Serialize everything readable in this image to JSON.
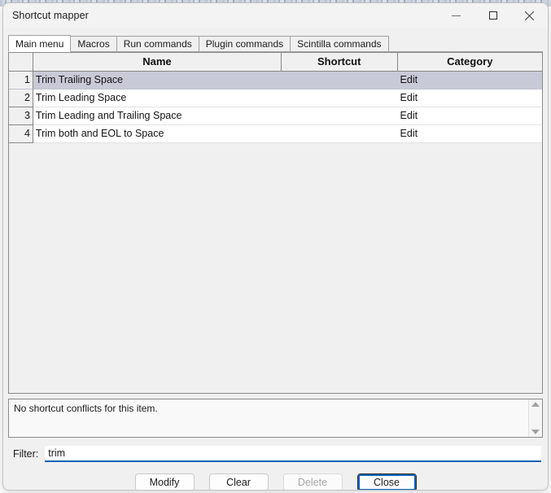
{
  "window": {
    "title": "Shortcut mapper",
    "controls": [
      {
        "name": "minimize",
        "icon": "minimize-icon"
      },
      {
        "name": "maximize",
        "icon": "maximize-icon"
      },
      {
        "name": "close",
        "icon": "close-icon"
      }
    ]
  },
  "tabs": [
    {
      "label": "Main menu",
      "active": true
    },
    {
      "label": "Macros",
      "active": false
    },
    {
      "label": "Run commands",
      "active": false
    },
    {
      "label": "Plugin commands",
      "active": false
    },
    {
      "label": "Scintilla commands",
      "active": false
    }
  ],
  "table": {
    "columns": [
      "",
      "Name",
      "Shortcut",
      "Category"
    ],
    "rows": [
      {
        "num": "1",
        "name": "Trim Trailing Space",
        "shortcut": "",
        "category": "Edit",
        "selected": true
      },
      {
        "num": "2",
        "name": "Trim Leading Space",
        "shortcut": "",
        "category": "Edit",
        "selected": false
      },
      {
        "num": "3",
        "name": "Trim Leading and Trailing Space",
        "shortcut": "",
        "category": "Edit",
        "selected": false
      },
      {
        "num": "4",
        "name": "Trim both and EOL to Space",
        "shortcut": "",
        "category": "Edit",
        "selected": false
      }
    ]
  },
  "conflicts": {
    "message": "No shortcut conflicts for this item.",
    "scrollbar": {
      "up": "scroll-up-icon",
      "down": "scroll-down-icon"
    }
  },
  "filter": {
    "label": "Filter:",
    "value": "trim",
    "placeholder": ""
  },
  "buttons": [
    {
      "label": "Modify",
      "name": "modify-button",
      "state": "enabled"
    },
    {
      "label": "Clear",
      "name": "clear-button",
      "state": "enabled"
    },
    {
      "label": "Delete",
      "name": "delete-button",
      "state": "disabled"
    },
    {
      "label": "Close",
      "name": "close-button",
      "state": "default"
    }
  ],
  "colors": {
    "selection": "#c9cad8",
    "focus_accent": "#0a62b8",
    "window_bg": "#f0f0f0",
    "titlebar_bg": "#f3f3f3"
  }
}
